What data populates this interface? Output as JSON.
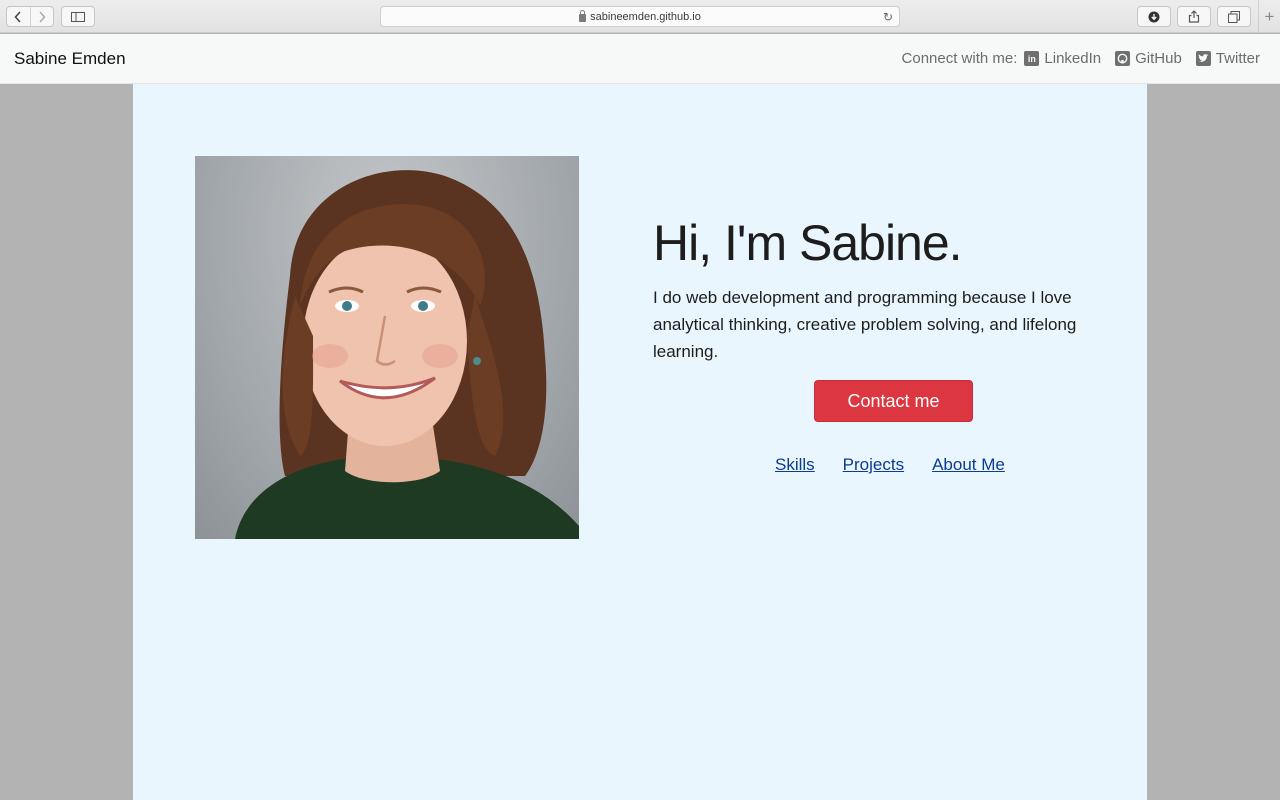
{
  "browser": {
    "url": "sabineemden.github.io"
  },
  "header": {
    "brand": "Sabine Emden",
    "connect_label": "Connect with me:",
    "social_links": [
      {
        "label": "LinkedIn",
        "icon": "linkedin-icon"
      },
      {
        "label": "GitHub",
        "icon": "github-icon"
      },
      {
        "label": "Twitter",
        "icon": "twitter-icon"
      }
    ]
  },
  "hero": {
    "headline": "Hi, I'm Sabine.",
    "bio": "I do web development and programming because I love analytical thinking, creative problem solving, and lifelong learning.",
    "contact_button": "Contact me",
    "section_links": [
      "Skills",
      "Projects",
      "About Me"
    ]
  },
  "colors": {
    "page_background": "#b3b3b3",
    "content_background": "#eaf6fd",
    "accent_button": "#dc3741",
    "link": "#0b3b92"
  }
}
